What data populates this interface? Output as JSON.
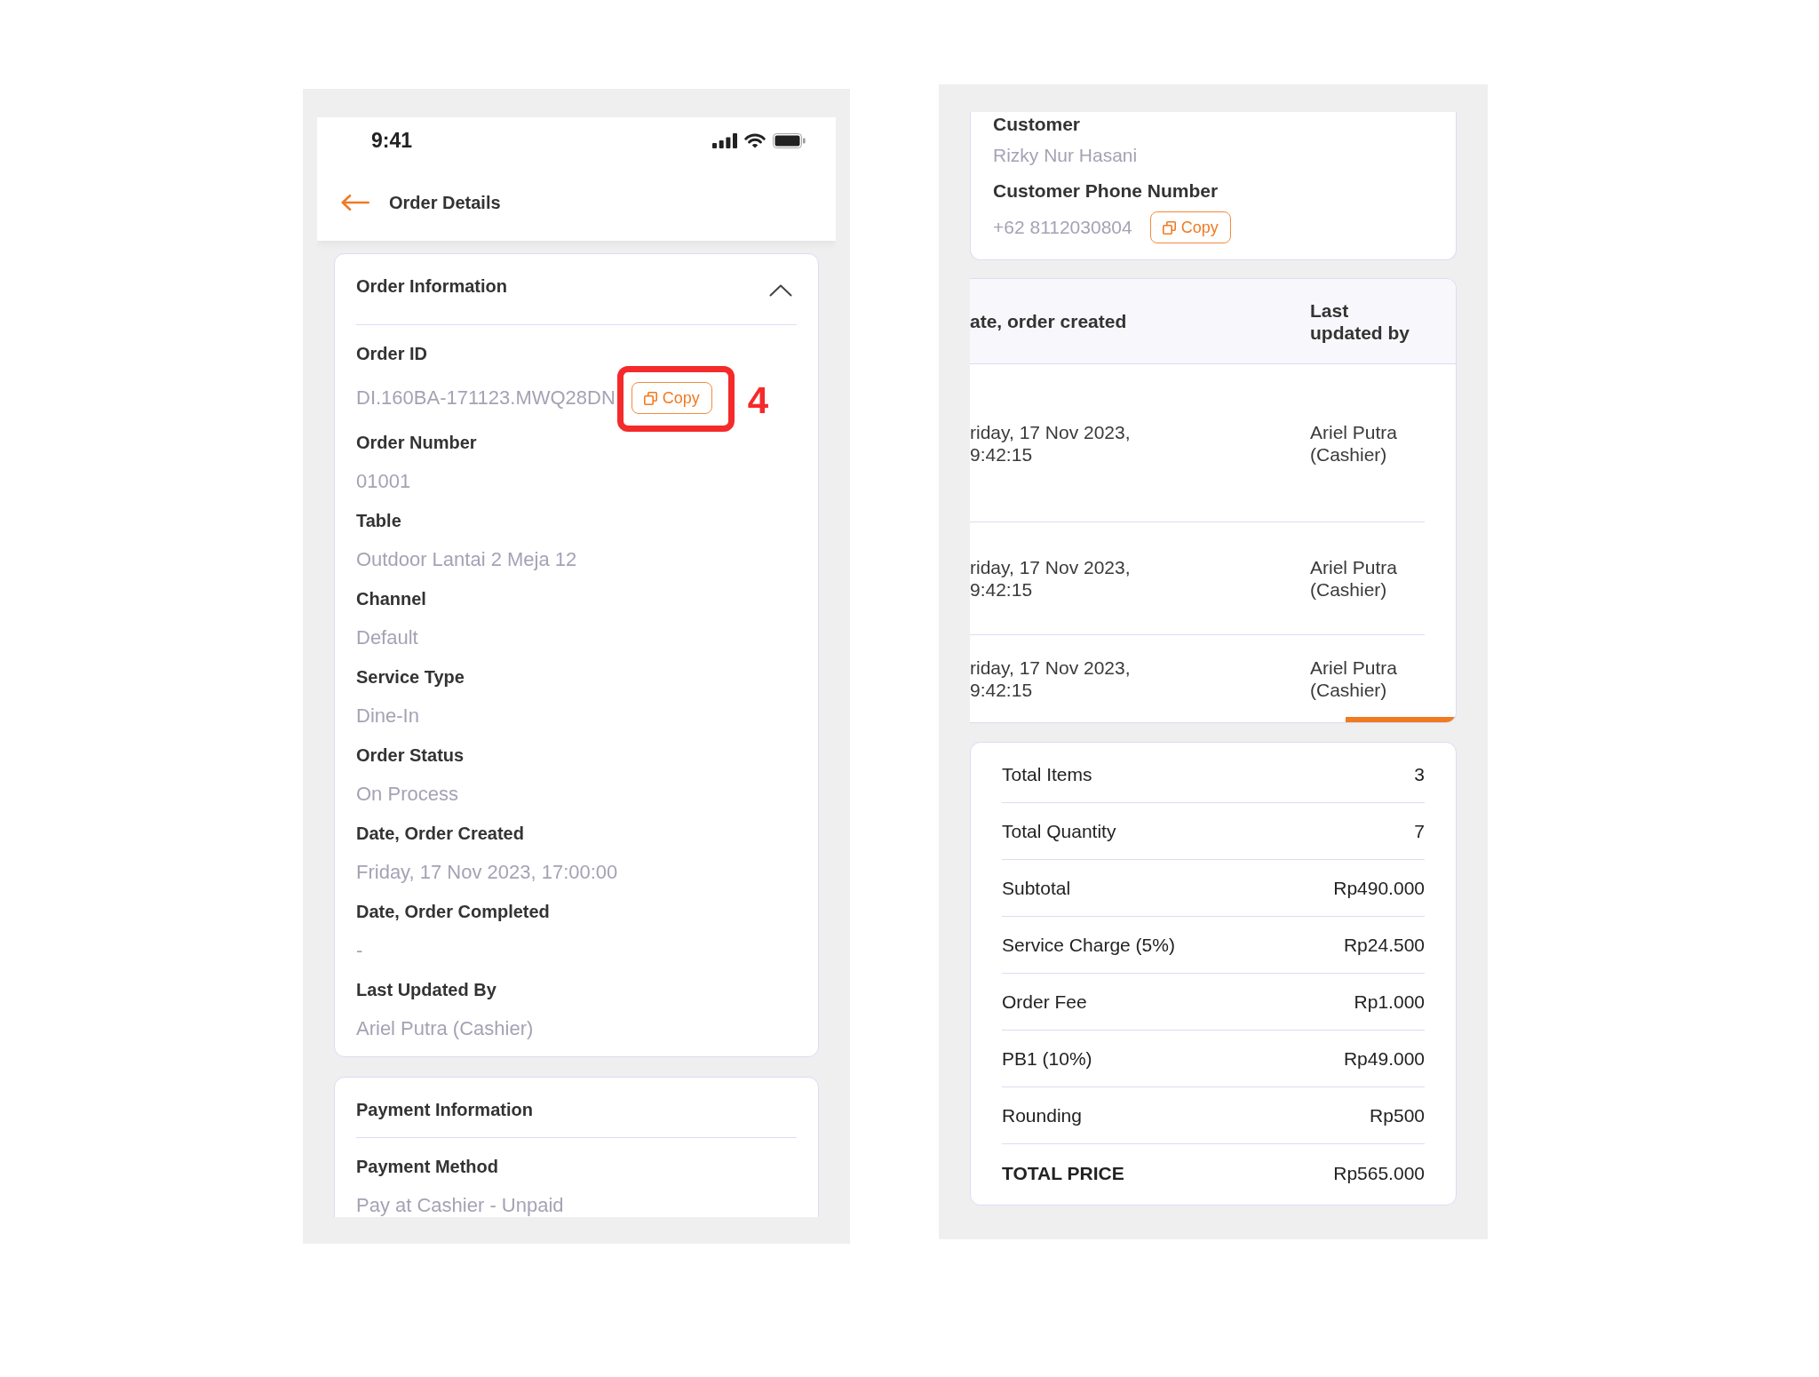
{
  "left_screen": {
    "status_bar": {
      "time": "9:41"
    },
    "header": {
      "title": "Order Details"
    },
    "sections": [
      {
        "title": "Order Information",
        "expanded": true,
        "fields": [
          {
            "label": "Order ID",
            "value": "DI.160BA-171123.MWQ28DN",
            "copy_button": {
              "label": "Copy"
            },
            "annotation": {
              "label": "4"
            }
          },
          {
            "label": "Order Number",
            "value": "01001"
          },
          {
            "label": "Table",
            "value": "Outdoor Lantai 2 Meja 12"
          },
          {
            "label": "Channel",
            "value": "Default"
          },
          {
            "label": "Service Type",
            "value": "Dine-In"
          },
          {
            "label": "Order Status",
            "value": "On Process"
          },
          {
            "label": "Date, Order Created",
            "value": "Friday, 17 Nov 2023, 17:00:00"
          },
          {
            "label": "Date, Order Completed",
            "value": "-"
          },
          {
            "label": "Last Updated By",
            "value": "Ariel Putra (Cashier)"
          }
        ]
      },
      {
        "title": "Payment Information",
        "fields": [
          {
            "label": "Payment Method",
            "value": "Pay at Cashier - Unpaid"
          }
        ]
      }
    ]
  },
  "right_screen": {
    "customer_section": {
      "fields": [
        {
          "label": "Customer",
          "value": "Rizky Nur Hasani"
        },
        {
          "label": "Customer Phone Number",
          "value": "+62 8112030804",
          "copy_button": {
            "label": "Copy"
          }
        }
      ]
    },
    "history_table": {
      "columns": [
        "ate, order created",
        "Last updated by"
      ],
      "rows": [
        [
          "riday, 17 Nov 2023, 9:42:15",
          "Ariel Putra (Cashier)"
        ],
        [
          "riday, 17 Nov 2023, 9:42:15",
          "Ariel Putra (Cashier)"
        ],
        [
          "riday, 17 Nov 2023, 9:42:15",
          "Ariel Putra (Cashier)"
        ]
      ]
    },
    "summary": {
      "rows": [
        {
          "kind": "line",
          "label": "Total Items",
          "value": "3"
        },
        {
          "kind": "line",
          "label": "Total Quantity",
          "value": "7"
        },
        {
          "kind": "line",
          "label": "Subtotal",
          "value": "Rp490.000"
        },
        {
          "kind": "line",
          "label": "Service Charge (5%)",
          "value": "Rp24.500"
        },
        {
          "kind": "line",
          "label": "Order Fee",
          "value": "Rp1.000"
        },
        {
          "kind": "line",
          "label": "PB1 (10%)",
          "value": "Rp49.000"
        },
        {
          "kind": "line",
          "label": "Rounding",
          "value": "Rp500"
        },
        {
          "kind": "total",
          "label": "TOTAL PRICE",
          "value": "Rp565.000"
        }
      ]
    }
  }
}
